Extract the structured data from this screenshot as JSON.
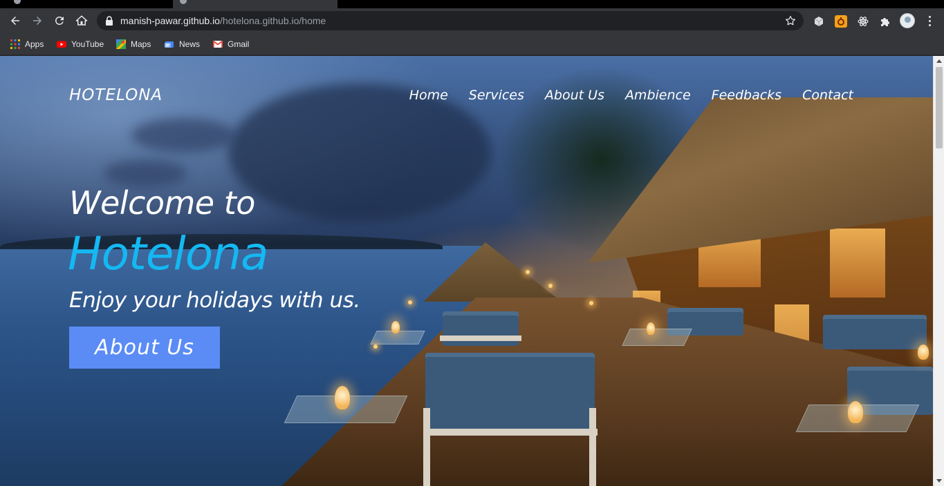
{
  "browser": {
    "url_host": "manish-pawar.github.io",
    "url_path": "/hotelona.github.io/home",
    "bookmarks": [
      {
        "label": "Apps",
        "icon": "apps-grid-icon"
      },
      {
        "label": "YouTube",
        "icon": "youtube-icon"
      },
      {
        "label": "Maps",
        "icon": "maps-icon"
      },
      {
        "label": "News",
        "icon": "news-icon"
      },
      {
        "label": "Gmail",
        "icon": "gmail-icon"
      }
    ]
  },
  "site": {
    "logo": "HOTELONA",
    "nav": [
      "Home",
      "Services",
      "About Us",
      "Ambience",
      "Feedbacks",
      "Contact"
    ],
    "hero": {
      "line1": "Welcome to",
      "line2": "Hotelona",
      "line3": "Enjoy your holidays with us.",
      "cta": "About Us"
    }
  },
  "colors": {
    "accent_text": "#14b8f2",
    "cta_bg": "#5b8cf5",
    "chrome_bg": "#35363a"
  }
}
